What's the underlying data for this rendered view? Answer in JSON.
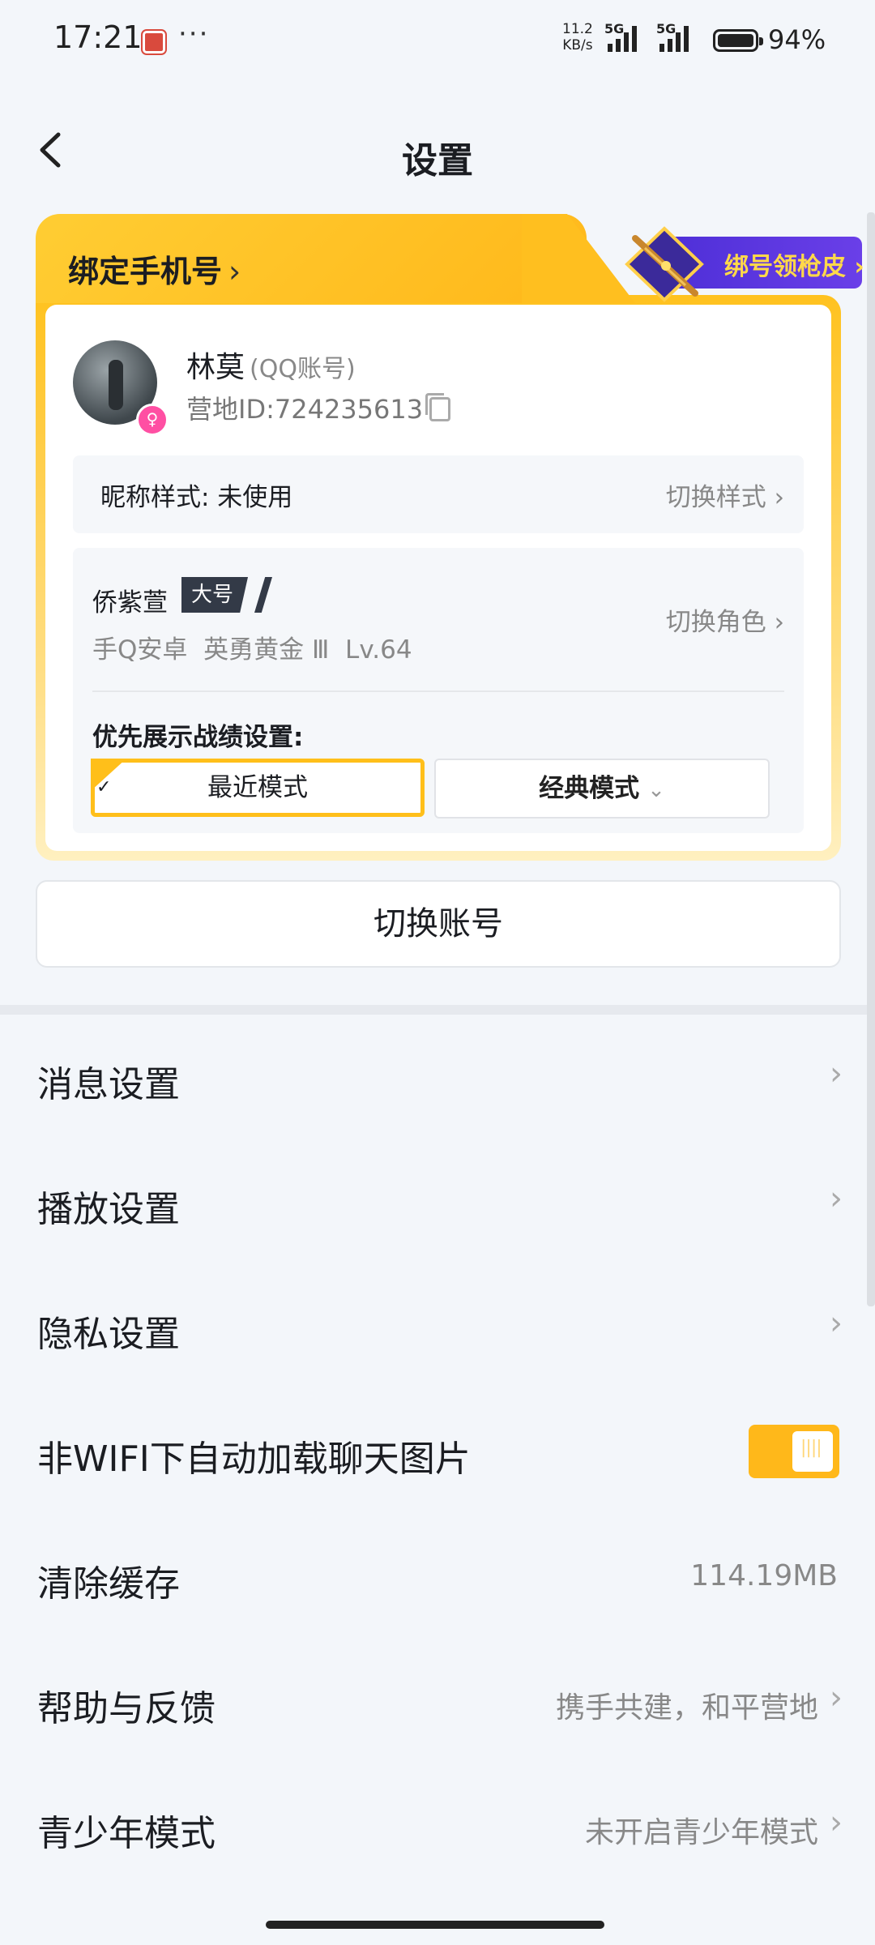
{
  "status_bar": {
    "time": "17:21",
    "dots": "···",
    "speed_value": "11.2",
    "speed_unit": "KB/s",
    "sim1": "5G",
    "sim2": "5G",
    "battery_pct": "94%"
  },
  "header": {
    "title": "设置"
  },
  "binding": {
    "tab_label": "绑定手机号",
    "chevron": "›",
    "promo_label": "绑号领枪皮 ›"
  },
  "profile": {
    "name": "林莫",
    "account_type": "(QQ账号)",
    "camp_id": "营地ID:724235613",
    "gender_symbol": "♀"
  },
  "nickname_style": {
    "label": "昵称样式: 未使用",
    "action": "切换样式 ›"
  },
  "role": {
    "name": "侨紫萱",
    "tag": "大号",
    "meta": "手Q安卓  英勇黄金 Ⅲ  Lv.64",
    "switch": "切换角色 ›",
    "pref_label": "优先展示战绩设置:",
    "mode_recent": "最近模式",
    "mode_classic": "经典模式",
    "mode_classic_arrow": "⌄",
    "check": "✓"
  },
  "switch_account": "切换账号",
  "settings": [
    {
      "label": "消息设置",
      "chevron": "›"
    },
    {
      "label": "播放设置",
      "chevron": "›"
    },
    {
      "label": "隐私设置",
      "chevron": "›"
    },
    {
      "label": "非WIFI下自动加载聊天图片",
      "toggle_on": true
    },
    {
      "label": "清除缓存",
      "value": "114.19MB"
    },
    {
      "label": "帮助与反馈",
      "value": "携手共建，和平营地",
      "chevron": "›"
    },
    {
      "label": "青少年模式",
      "value": "未开启青少年模式",
      "chevron": "›"
    }
  ],
  "colors": {
    "accent": "#ffbf1a",
    "promo": "#5a36e0",
    "gender": "#ff4fa3"
  }
}
